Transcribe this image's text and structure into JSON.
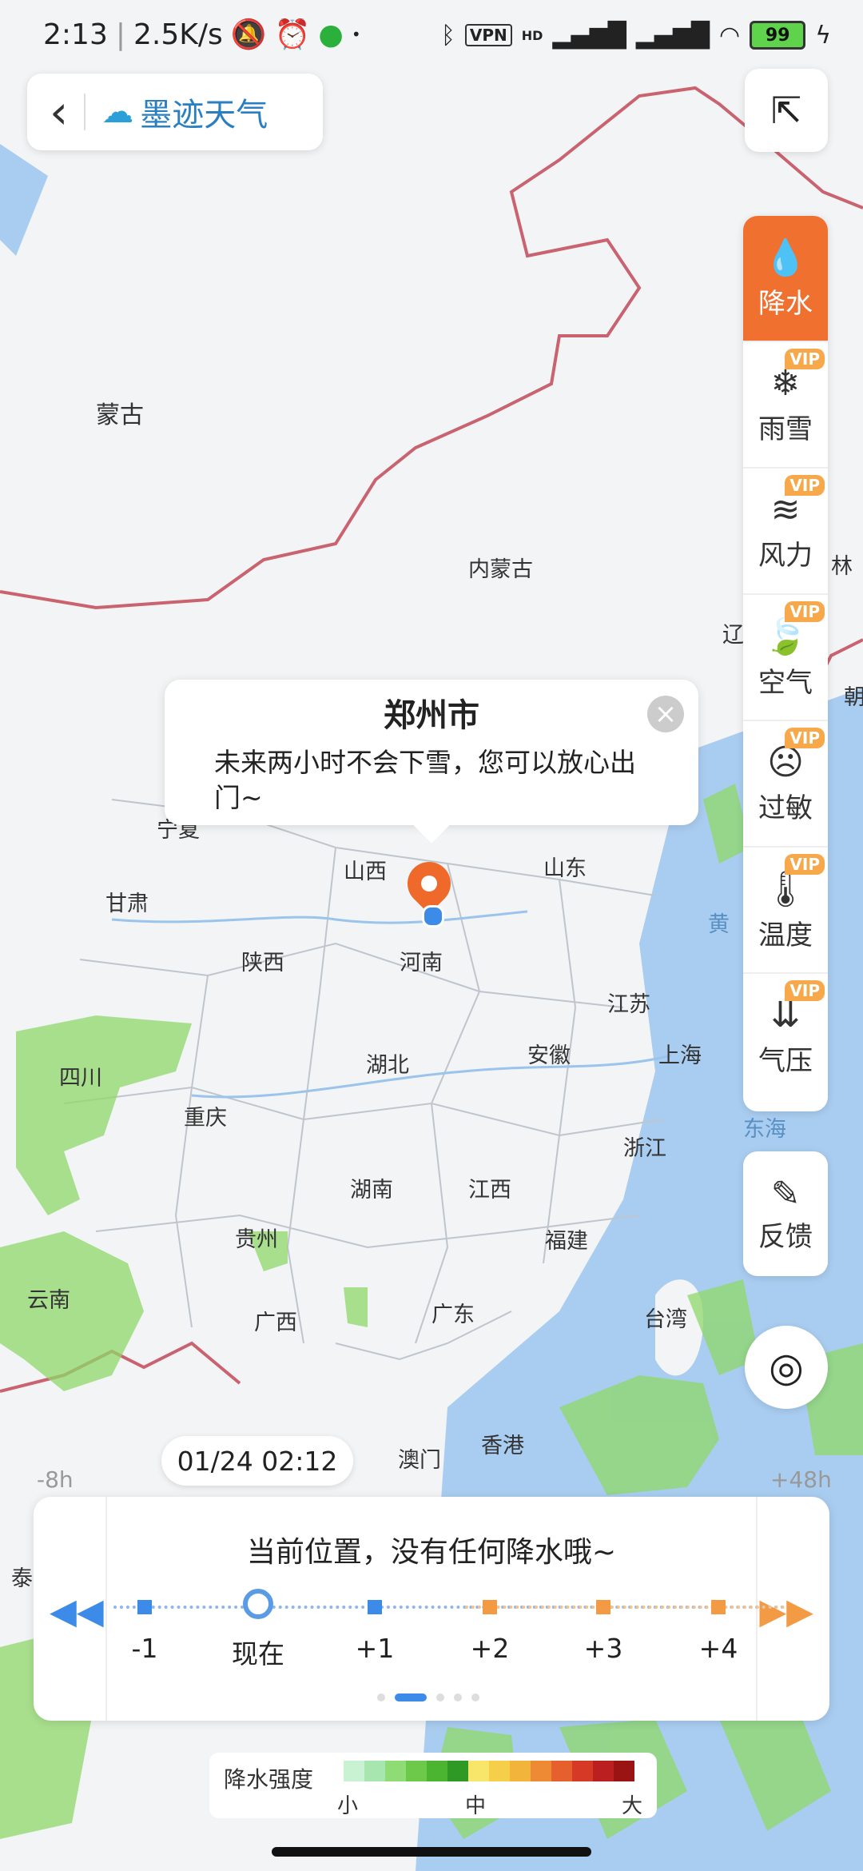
{
  "status": {
    "time": "2:13",
    "speed": "2.5K/s",
    "vpn": "VPN",
    "hd": "HD",
    "battery": "99"
  },
  "header": {
    "back_icon": "‹",
    "app_name": "墨迹天气"
  },
  "share_icon": "share-icon",
  "sidebar": {
    "items": [
      {
        "label": "降水",
        "icon": "💧",
        "vip": false,
        "active": true
      },
      {
        "label": "雨雪",
        "icon": "❄",
        "vip": true
      },
      {
        "label": "风力",
        "icon": "≋",
        "vip": true
      },
      {
        "label": "空气",
        "icon": "🍃",
        "vip": true
      },
      {
        "label": "过敏",
        "icon": "☹",
        "vip": true
      },
      {
        "label": "温度",
        "icon": "🌡",
        "vip": true
      },
      {
        "label": "气压",
        "icon": "⇊",
        "vip": true
      }
    ],
    "vip_label": "VIP"
  },
  "feedback": {
    "label": "反馈",
    "icon": "✎"
  },
  "popup": {
    "city": "郑州市",
    "message": "未来两小时不会下雪，您可以放心出门~",
    "close": "×"
  },
  "map_labels": {
    "mongolia": "蒙古",
    "inner_mongolia": "内蒙古",
    "shanxi": "山西",
    "shandong": "山东",
    "gansu": "甘肃",
    "shaanxi": "陕西",
    "henan": "河南",
    "jiangsu": "江苏",
    "sichuan": "四川",
    "hubei": "湖北",
    "anhui": "安徽",
    "shanghai": "上海",
    "chongqing": "重庆",
    "zhejiang": "浙江",
    "hunan": "湖南",
    "jiangxi": "江西",
    "guizhou": "贵州",
    "fujian": "福建",
    "yunnan": "云南",
    "guangxi": "广西",
    "guangdong": "广东",
    "taiwan": "台湾",
    "macau": "澳门",
    "hongkong": "香港",
    "liao": "辽",
    "ning": "宁夏",
    "lin": "林",
    "chao": "朝",
    "huang": "黄",
    "donghai": "东海",
    "tai": "泰"
  },
  "time_badge": "01/24 02:12",
  "time_range": {
    "start": "-8h",
    "end": "+48h"
  },
  "panel": {
    "title": "当前位置，没有任何降水哦~",
    "ticks": [
      "-1",
      "现在",
      "+1",
      "+2",
      "+3",
      "+4"
    ]
  },
  "legend": {
    "title": "降水强度",
    "low": "小",
    "mid": "中",
    "high": "大"
  },
  "colors": {
    "accent": "#f0702f",
    "blue": "#3c8be8",
    "sea": "#a9cdf0"
  }
}
